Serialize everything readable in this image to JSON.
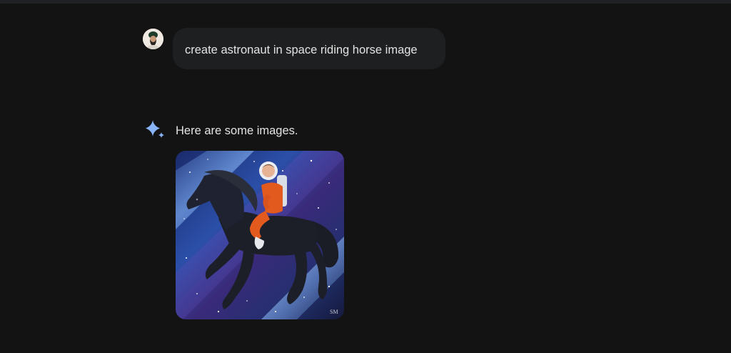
{
  "conversation": {
    "user_message": {
      "text": "create astronaut in space riding horse image",
      "avatar": "user-avatar"
    },
    "response": {
      "icon": "sparkle-icon",
      "text": "Here are some images.",
      "images": [
        {
          "subject": "astronaut-riding-horse-in-space",
          "signature": "SM"
        }
      ]
    }
  },
  "colors": {
    "background": "#131314",
    "bubble": "#1e1f20",
    "text": "#e3e3e3",
    "sparkle": "#8ab4f8"
  }
}
